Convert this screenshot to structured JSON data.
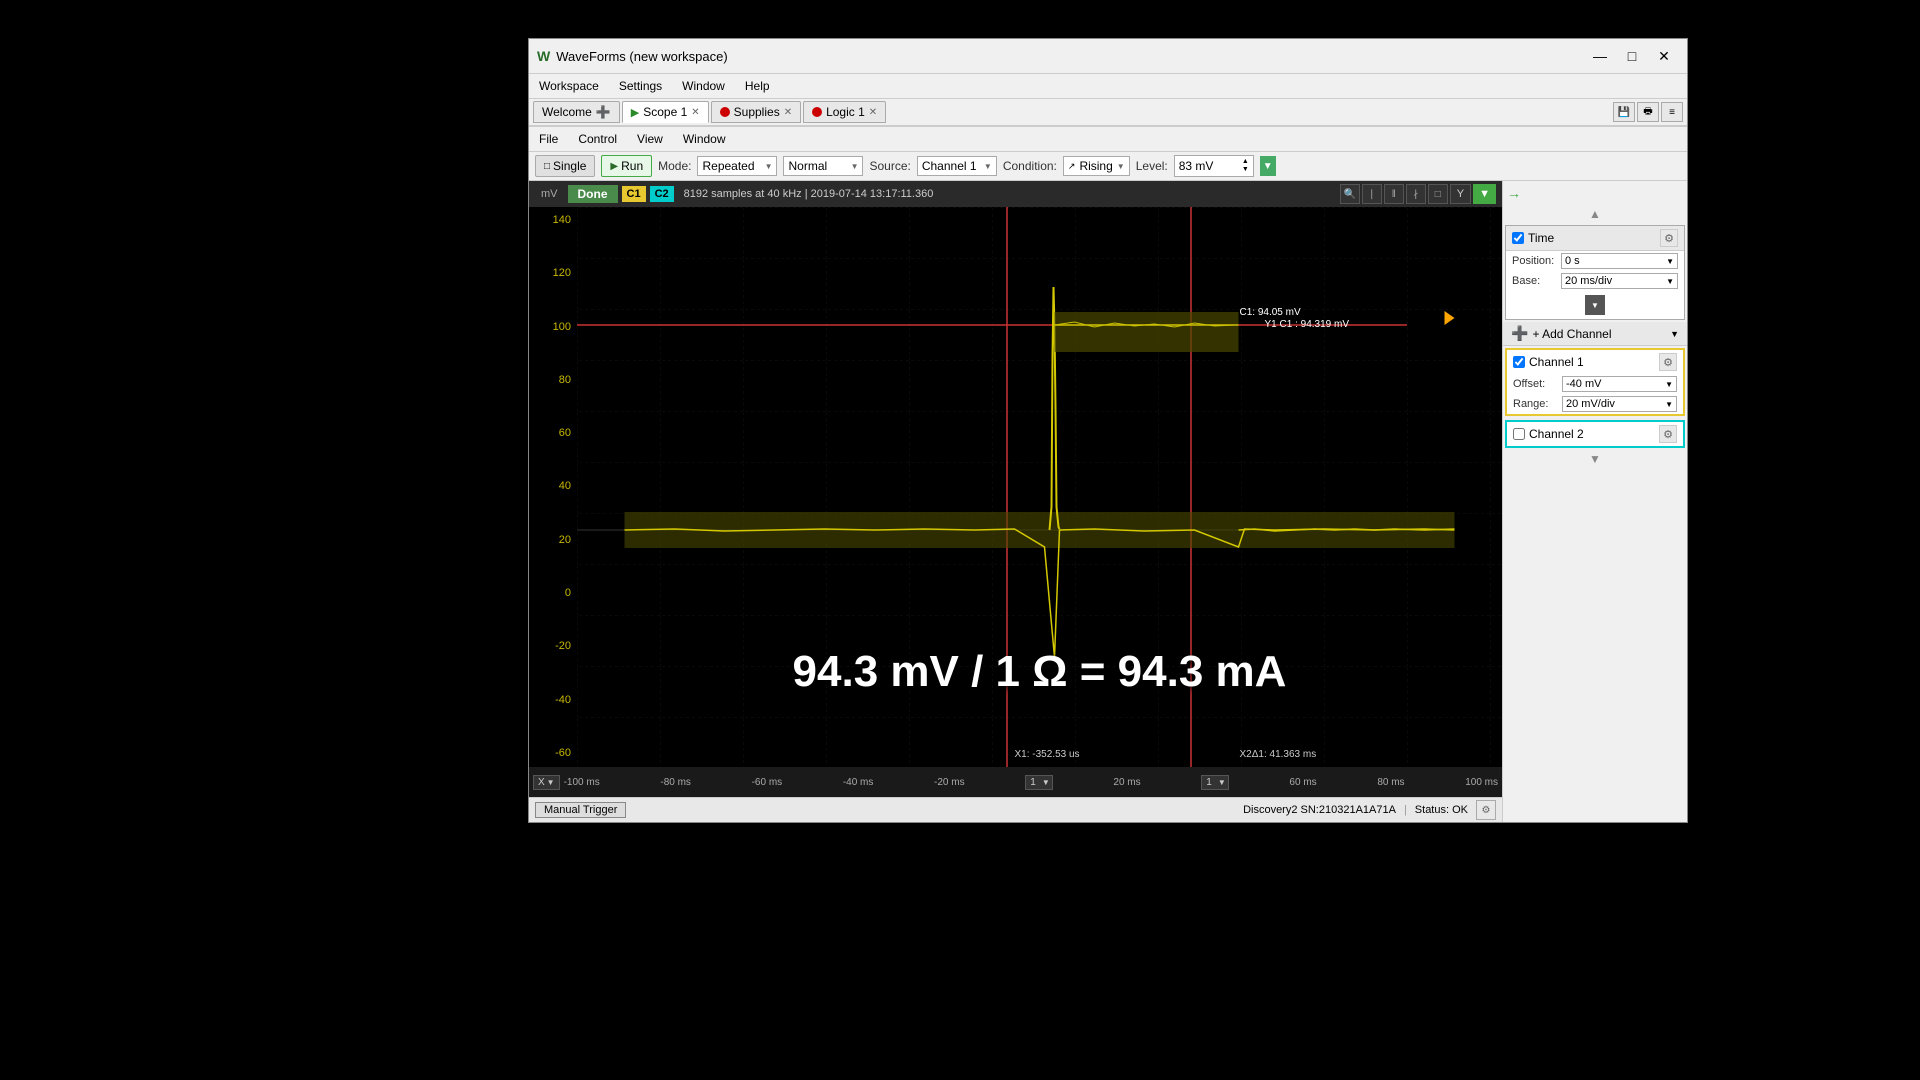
{
  "window": {
    "title": "WaveForms (new workspace)",
    "logo": "W"
  },
  "menu": {
    "items": [
      "Workspace",
      "Settings",
      "Window",
      "Help"
    ]
  },
  "tabs": [
    {
      "label": "Welcome",
      "icon": "plus",
      "type": "welcome",
      "active": false
    },
    {
      "label": "Scope 1",
      "icon": "scope",
      "type": "scope",
      "active": true,
      "closable": true
    },
    {
      "label": "Supplies",
      "icon": "red-dot",
      "type": "supplies",
      "active": false,
      "closable": true
    },
    {
      "label": "Logic 1",
      "icon": "red-dot",
      "type": "logic",
      "active": false,
      "closable": true
    }
  ],
  "toolbar2": {
    "items": [
      "File",
      "Control",
      "View",
      "Window"
    ]
  },
  "scope_toolbar": {
    "single_label": "Single",
    "run_label": "Run",
    "mode_label": "Mode:",
    "mode_value": "Repeated",
    "trigger_label": "Normal",
    "source_label": "Source:",
    "source_value": "Channel 1",
    "condition_label": "Condition:",
    "condition_value": "Rising",
    "level_label": "Level:",
    "level_value": "83 mV"
  },
  "scope_header": {
    "unit": "mV",
    "done_label": "Done",
    "ch1_label": "C1",
    "ch2_label": "C2",
    "info": "8192 samples at 40 kHz  |  2019-07-14  13:17:11.360"
  },
  "waveform": {
    "y_labels": [
      "140",
      "120",
      "100",
      "80",
      "60",
      "40",
      "20",
      "0",
      "-20",
      "-40",
      "-60"
    ],
    "x_labels": [
      "-100 ms",
      "-80 ms",
      "-60 ms",
      "-40 ms",
      "-20 ms",
      "1",
      "20 ms",
      "1",
      "60 ms",
      "80 ms",
      "100 ms"
    ],
    "cursor1_label": "X1: -352.53 us",
    "cursor2_label": "X2Δ1: 41.363 ms",
    "c1_value": "C1: 94.05 mV",
    "y1_value": "Y1 C1 : 94.319 mV",
    "measurement": "94.3 mV / 1 Ω = 94.3 mA"
  },
  "right_panel": {
    "time_section": {
      "label": "Time",
      "position_label": "Position:",
      "position_value": "0 s",
      "base_label": "Base:",
      "base_value": "20 ms/div"
    },
    "add_channel_label": "+ Add Channel",
    "channel1": {
      "label": "Channel 1",
      "checked": true,
      "offset_label": "Offset:",
      "offset_value": "-40 mV",
      "range_label": "Range:",
      "range_value": "20 mV/div"
    },
    "channel2": {
      "label": "Channel 2",
      "checked": false
    }
  },
  "status_bar": {
    "manual_trigger": "Manual Trigger",
    "device": "Discovery2 SN:210321A1A71A",
    "status": "Status: OK"
  }
}
